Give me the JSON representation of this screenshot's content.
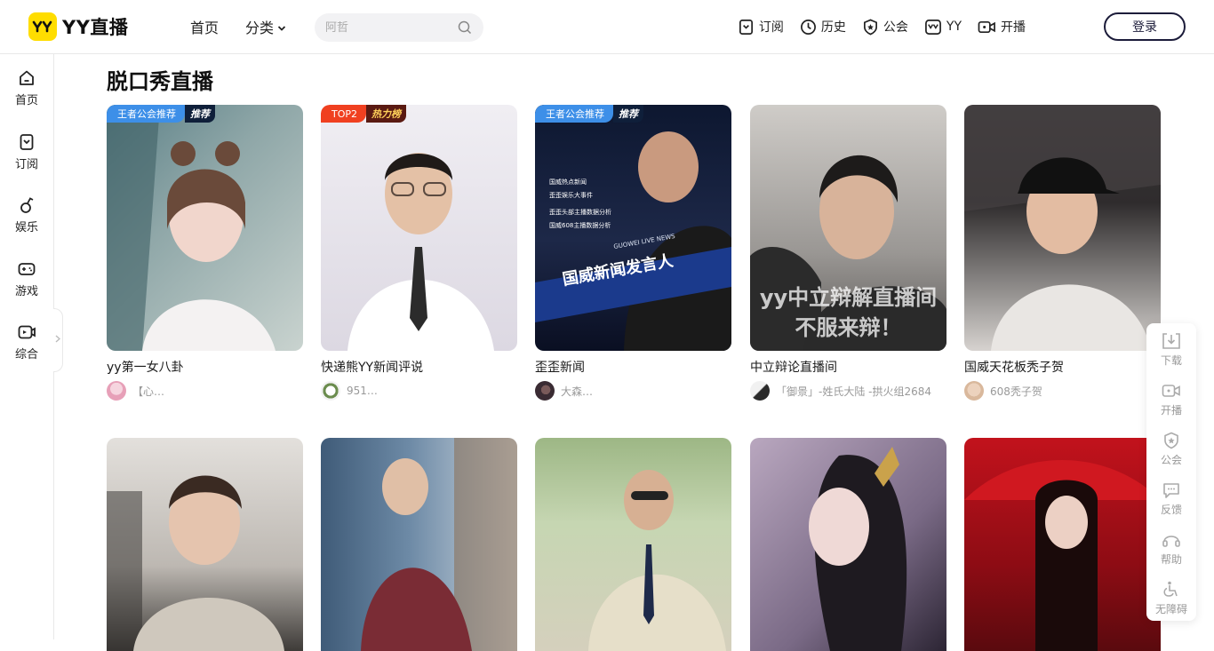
{
  "brand": {
    "name": "YY直播",
    "badge_text": "yy",
    "badge_color": "#ffdd00"
  },
  "nav": {
    "home": "首页",
    "category": "分类"
  },
  "search": {
    "placeholder": "阿哲"
  },
  "top_actions": [
    {
      "label": "订阅",
      "icon": "bookmark-icon"
    },
    {
      "label": "历史",
      "icon": "clock-icon"
    },
    {
      "label": "公会",
      "icon": "shield-star-icon"
    },
    {
      "label": "YY",
      "icon": "yy-icon"
    },
    {
      "label": "开播",
      "icon": "video-camera-icon"
    }
  ],
  "login": {
    "label": "登录"
  },
  "sidebar": [
    {
      "label": "首页",
      "icon": "home-icon"
    },
    {
      "label": "订阅",
      "icon": "bookmark-icon"
    },
    {
      "label": "娱乐",
      "icon": "music-note-icon"
    },
    {
      "label": "游戏",
      "icon": "gamepad-icon"
    },
    {
      "label": "综合",
      "icon": "tv-icon"
    }
  ],
  "section": {
    "title": "脱口秀直播"
  },
  "cards": [
    {
      "title": "yy第一女八卦",
      "anchor": "【心…",
      "tag": [
        "王者公会推荐",
        "推荐"
      ],
      "tag_style": "blue",
      "thumb_colors": [
        "#5a7f86",
        "#c9d3cf"
      ],
      "avatar_color": "#e7a0b8"
    },
    {
      "title": "快递熊YY新闻评说",
      "anchor": "951…",
      "tag": [
        "TOP2",
        "热力榜"
      ],
      "tag_style": "red",
      "thumb_colors": [
        "#ebe8ef",
        "#cfcad6"
      ],
      "avatar_color": "#6b8c4e"
    },
    {
      "title": "歪歪新闻",
      "anchor": "大森…",
      "tag": [
        "王者公会推荐",
        "推荐"
      ],
      "tag_style": "blue",
      "thumb_colors": [
        "#0d1730",
        "#1d2848"
      ],
      "avatar_color": "#3a2b33",
      "overlay_lines": [
        "国威热点新闻",
        "歪歪娱乐大事件",
        "歪歪头部主播数据分析",
        "国威608主播数据分析"
      ],
      "overlay_sub": "GUOWEI LIVE NEWS",
      "overlay_banner": "国威新闻发言人"
    },
    {
      "title": "中立辩论直播间",
      "anchor": "「御景」-姓氏大陆 -拱火组2684",
      "tag": [],
      "tag_style": "",
      "thumb_colors": [
        "#b7b4b0",
        "#5b5856"
      ],
      "avatar_color": "#2a2a2a",
      "overlay_big": [
        "yy中立辩解直播间",
        "不服来辩！"
      ]
    },
    {
      "title": "国威天花板秃子贺",
      "anchor": "608秃子贺",
      "tag": [],
      "tag_style": "",
      "thumb_colors": [
        "#2f2c2d",
        "#d6d2cf"
      ],
      "avatar_color": "#d9b89c"
    },
    {
      "title": "",
      "anchor": "",
      "tag": [],
      "tag_style": "",
      "thumb_colors": [
        "#d9d6d2",
        "#3e3b38"
      ],
      "avatar_color": ""
    },
    {
      "title": "",
      "anchor": "",
      "tag": [],
      "tag_style": "",
      "thumb_colors": [
        "#3f5b78",
        "#7a2c35"
      ],
      "avatar_color": ""
    },
    {
      "title": "",
      "anchor": "",
      "tag": [],
      "tag_style": "",
      "thumb_colors": [
        "#9db785",
        "#d5d0bd"
      ],
      "avatar_color": ""
    },
    {
      "title": "",
      "anchor": "",
      "tag": [],
      "tag_style": "",
      "thumb_colors": [
        "#b9a7bf",
        "#2c2534"
      ],
      "avatar_color": ""
    },
    {
      "title": "",
      "anchor": "",
      "tag": [],
      "tag_style": "",
      "thumb_colors": [
        "#c2121c",
        "#5a0a0e"
      ],
      "avatar_color": ""
    }
  ],
  "float_bar": [
    {
      "label": "下载",
      "icon": "download-icon"
    },
    {
      "label": "开播",
      "icon": "video-camera-icon"
    },
    {
      "label": "公会",
      "icon": "shield-star-icon"
    },
    {
      "label": "反馈",
      "icon": "chat-icon"
    },
    {
      "label": "帮助",
      "icon": "headset-icon"
    },
    {
      "label": "无障碍",
      "icon": "accessibility-icon"
    }
  ]
}
